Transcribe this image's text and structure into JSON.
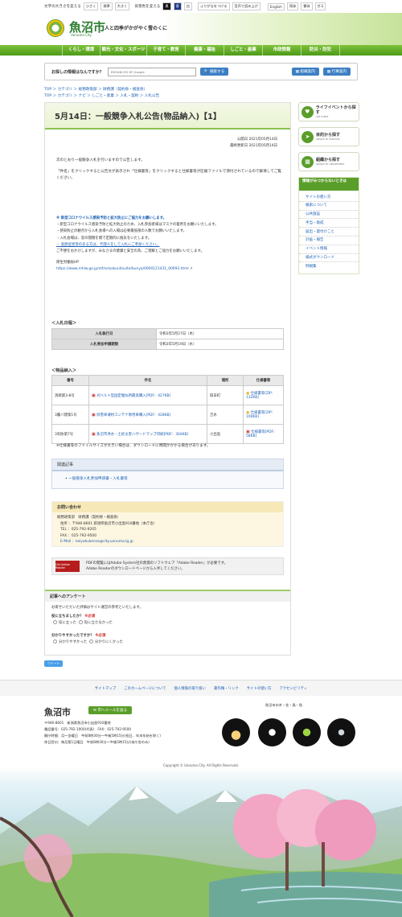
{
  "topbar": {
    "font_size_label": "文字の大きさを変える",
    "font_sizes": [
      "小さく",
      "標準",
      "大きく"
    ],
    "bg_color_label": "背景色を変える",
    "bg_colors": [
      "黒",
      "青",
      "白"
    ],
    "furigana": "ふりがなをつける",
    "speech": "音声で読み上げ",
    "languages": [
      "English",
      "简体",
      "繁体",
      "한국"
    ]
  },
  "header": {
    "logo_title": "魚沼市",
    "logo_romaji": "Uonuma City",
    "tagline": "人と四季がかがやく雪のくに"
  },
  "gnav": [
    "くらし・環境",
    "観光・文化・スポーツ",
    "子育て・教育",
    "健康・福祉",
    "しごと・産業",
    "市政情報",
    "防災・防犯"
  ],
  "search": {
    "label": "お探しの情報はなんですか？",
    "placeholder": "ENHANCED BY Google",
    "button": "検索する",
    "org_button": "組織案内",
    "event_button": "行事案内"
  },
  "breadcrumbs": [
    "TOP ＞ カテゴリ ＞ 総務政策部 ＞ 財務課（契約係・検査係）",
    "TOP ＞ カテゴリ ＞ ナビ ＞ しごと・産業 ＞ 入札・契約 ＞ 入札公告"
  ],
  "page": {
    "title": "5月14日：一般競争入札公告(物品納入)【1】",
    "published": "公開日 2021年05月14日",
    "updated": "最終更新日 2021年05月14日",
    "intro1": "次のとおり一般競争入札を行いますので公告します。",
    "intro2": "「件名」をクリックすると公告文が表示され「仕様書等」をクリックすると仕様書等が圧縮ファイルで添付されているので解凍してご覧ください。",
    "notice_head": "※ 新型コロナウイルス感染予防と拡大防止にご協力をお願いします。",
    "notice_lines": [
      "・新型コロナウイルス感染予防と拡大防止のため、入札参加者様はマスクの着用をお願いいたします。",
      "・感染防止の観点から入札会場への入場は必要最低限の人数でお願いいたします。",
      "・入札会場は、窓の開閉を間で定期的に換気をいたします。",
      "・ 高熱症状等のある方は、代理人をして入札にご参加ください。",
      "ご不便をおかけしますが、みなさまの健康と安全の為、ご理解とご協力をお願いいたします。"
    ],
    "mhlw_label": "厚生労働省HP",
    "mhlw_url": "https://www.mhlw.go.jp/stf/seisakunitsuite/bunya/0000121431_00093.html"
  },
  "schedule": {
    "heading": "＜入札日程＞",
    "rows": [
      {
        "label": "入札執行日",
        "value": "令和3年5月27日（木）"
      },
      {
        "label": "入札参加申請期限",
        "value": "令和3年5月19日（水）"
      }
    ]
  },
  "goods": {
    "heading": "＜物品納入＞",
    "headers": [
      "番号",
      "件名",
      "場所",
      "仕様書等"
    ],
    "rows": [
      {
        "no": "消耗第3-8号",
        "title": "刈ベルト型固定駆ね用最高購入[PDF：427KB]",
        "place": "四日町",
        "spec": "仕様書等[ZIP：132KB]"
      },
      {
        "no": "3農バ建第1号",
        "title": "除雪車運材コンテナ専用車購入[PDF：428KB]",
        "place": "吉水",
        "spec": "仕様書等[ZIP：100KB]"
      },
      {
        "no": "3有防第7号",
        "title": "魚沼市洪水・土砂災害ハザードマップ印刷[PDF：304KB]",
        "place": "小出島",
        "spec": "仕様書等[PDF：58KB]"
      }
    ],
    "note": "※仕様書等のファイルサイズが大きい場合は、ダウンロードに時間がかかる場合があります。"
  },
  "related": {
    "heading": "関連記事",
    "items": [
      "一般競争入札参加申請書・入札書等"
    ]
  },
  "contact": {
    "heading": "お問い合わせ",
    "dept": "総務政策部　財務課（契約係・検査係）",
    "address": "住所 ：〒946-8601 新潟県魚沼市小出島910番地（本庁舎）",
    "tel": "TEL ：025-792-9205",
    "fax": "FAX ：025-792-9500",
    "email": "E-Mail ：keiyakukensa@city.uonuma.lg.jp"
  },
  "adobe": {
    "logo": "Get Adobe Reader",
    "text1": "PDFの閲覧にはAdobe System社の無償のソフトウェア「Adobe Reader」が必要です。",
    "text2": "Adobe Readerのダウンロードページから入手してください。"
  },
  "survey": {
    "heading": "記事へのアンケート",
    "intro": "お寄せいただいた評価はサイト運営の参考といたします。",
    "q1": "役に立ちましたか？",
    "q1_opts": [
      "役に立った",
      "役に立たなかった"
    ],
    "q2": "分かりやすかったですか？",
    "q2_opts": [
      "分かりやすかった",
      "分かりにくかった"
    ],
    "required": "※必須"
  },
  "sidebar": {
    "buttons": [
      {
        "label": "ライフイベントから探す",
        "sub": "LIFE EVENT"
      },
      {
        "label": "目的から探す",
        "sub": "SEARCH BY PURPOSE"
      },
      {
        "label": "組織から探す",
        "sub": "SEARCH BY DEPARTMENT"
      }
    ],
    "list_heading": "情報がみつからないときは",
    "list": [
      "サイトの使い方",
      "検索について",
      "公共施設",
      "手当・助成",
      "届出・貸付けこと",
      "計画・報告",
      "イベント情報",
      "様式ダウンロード",
      "例規集"
    ]
  },
  "tweet": "ツイート",
  "footer_links": [
    "サイトマップ",
    "このホームページについて",
    "個人情報の取り扱い",
    "著作権・リンク",
    "サイトの使い方",
    "アクセシビリティ"
  ],
  "footer": {
    "name": "魚沼市",
    "mail": "市へメールを送る",
    "addr1": "〒946-8601　新潟県魚沼市小出島910番地",
    "addr2": "電話番号：025-792-1000(代表)　FAX：025-792-9500",
    "hours1": "開庁時間：月～金曜日　午前8時30分～午後5時15分(祝日、年末年始を除く)",
    "hours2": "休日窓口：毎月第1日曜日　午前8時30分～午後5時15分(本庁舎のみ)",
    "symbols": "魚沼市の木・花・鳥・魚",
    "copyright": "Copyright © Uonuma City. All Rights Reserved."
  }
}
